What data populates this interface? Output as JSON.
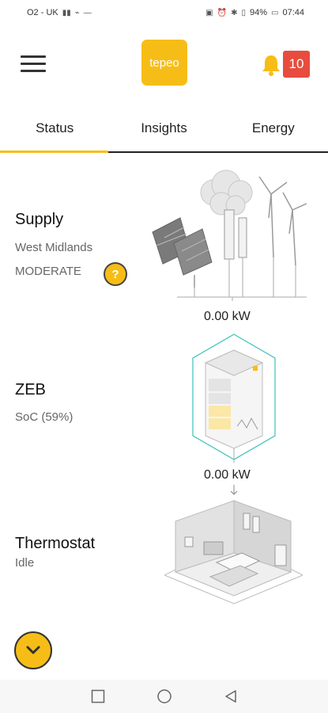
{
  "status_bar": {
    "carrier": "O2 - UK",
    "battery": "94%",
    "time": "07:44"
  },
  "header": {
    "logo_text": "tepeo",
    "notification_count": "10"
  },
  "tabs": [
    {
      "label": "Status"
    },
    {
      "label": "Insights"
    },
    {
      "label": "Energy"
    }
  ],
  "supply": {
    "title": "Supply",
    "region": "West Midlands",
    "level": "MODERATE",
    "help_symbol": "?",
    "power": "0.00 kW"
  },
  "zeb": {
    "title": "ZEB",
    "soc": "SoC (59%)",
    "power": "0.00 kW"
  },
  "thermostat": {
    "title": "Thermostat",
    "state": "Idle"
  },
  "colors": {
    "accent": "#f7bd17",
    "badge": "#e84c3d",
    "teal_outline": "#3ec1b8"
  }
}
